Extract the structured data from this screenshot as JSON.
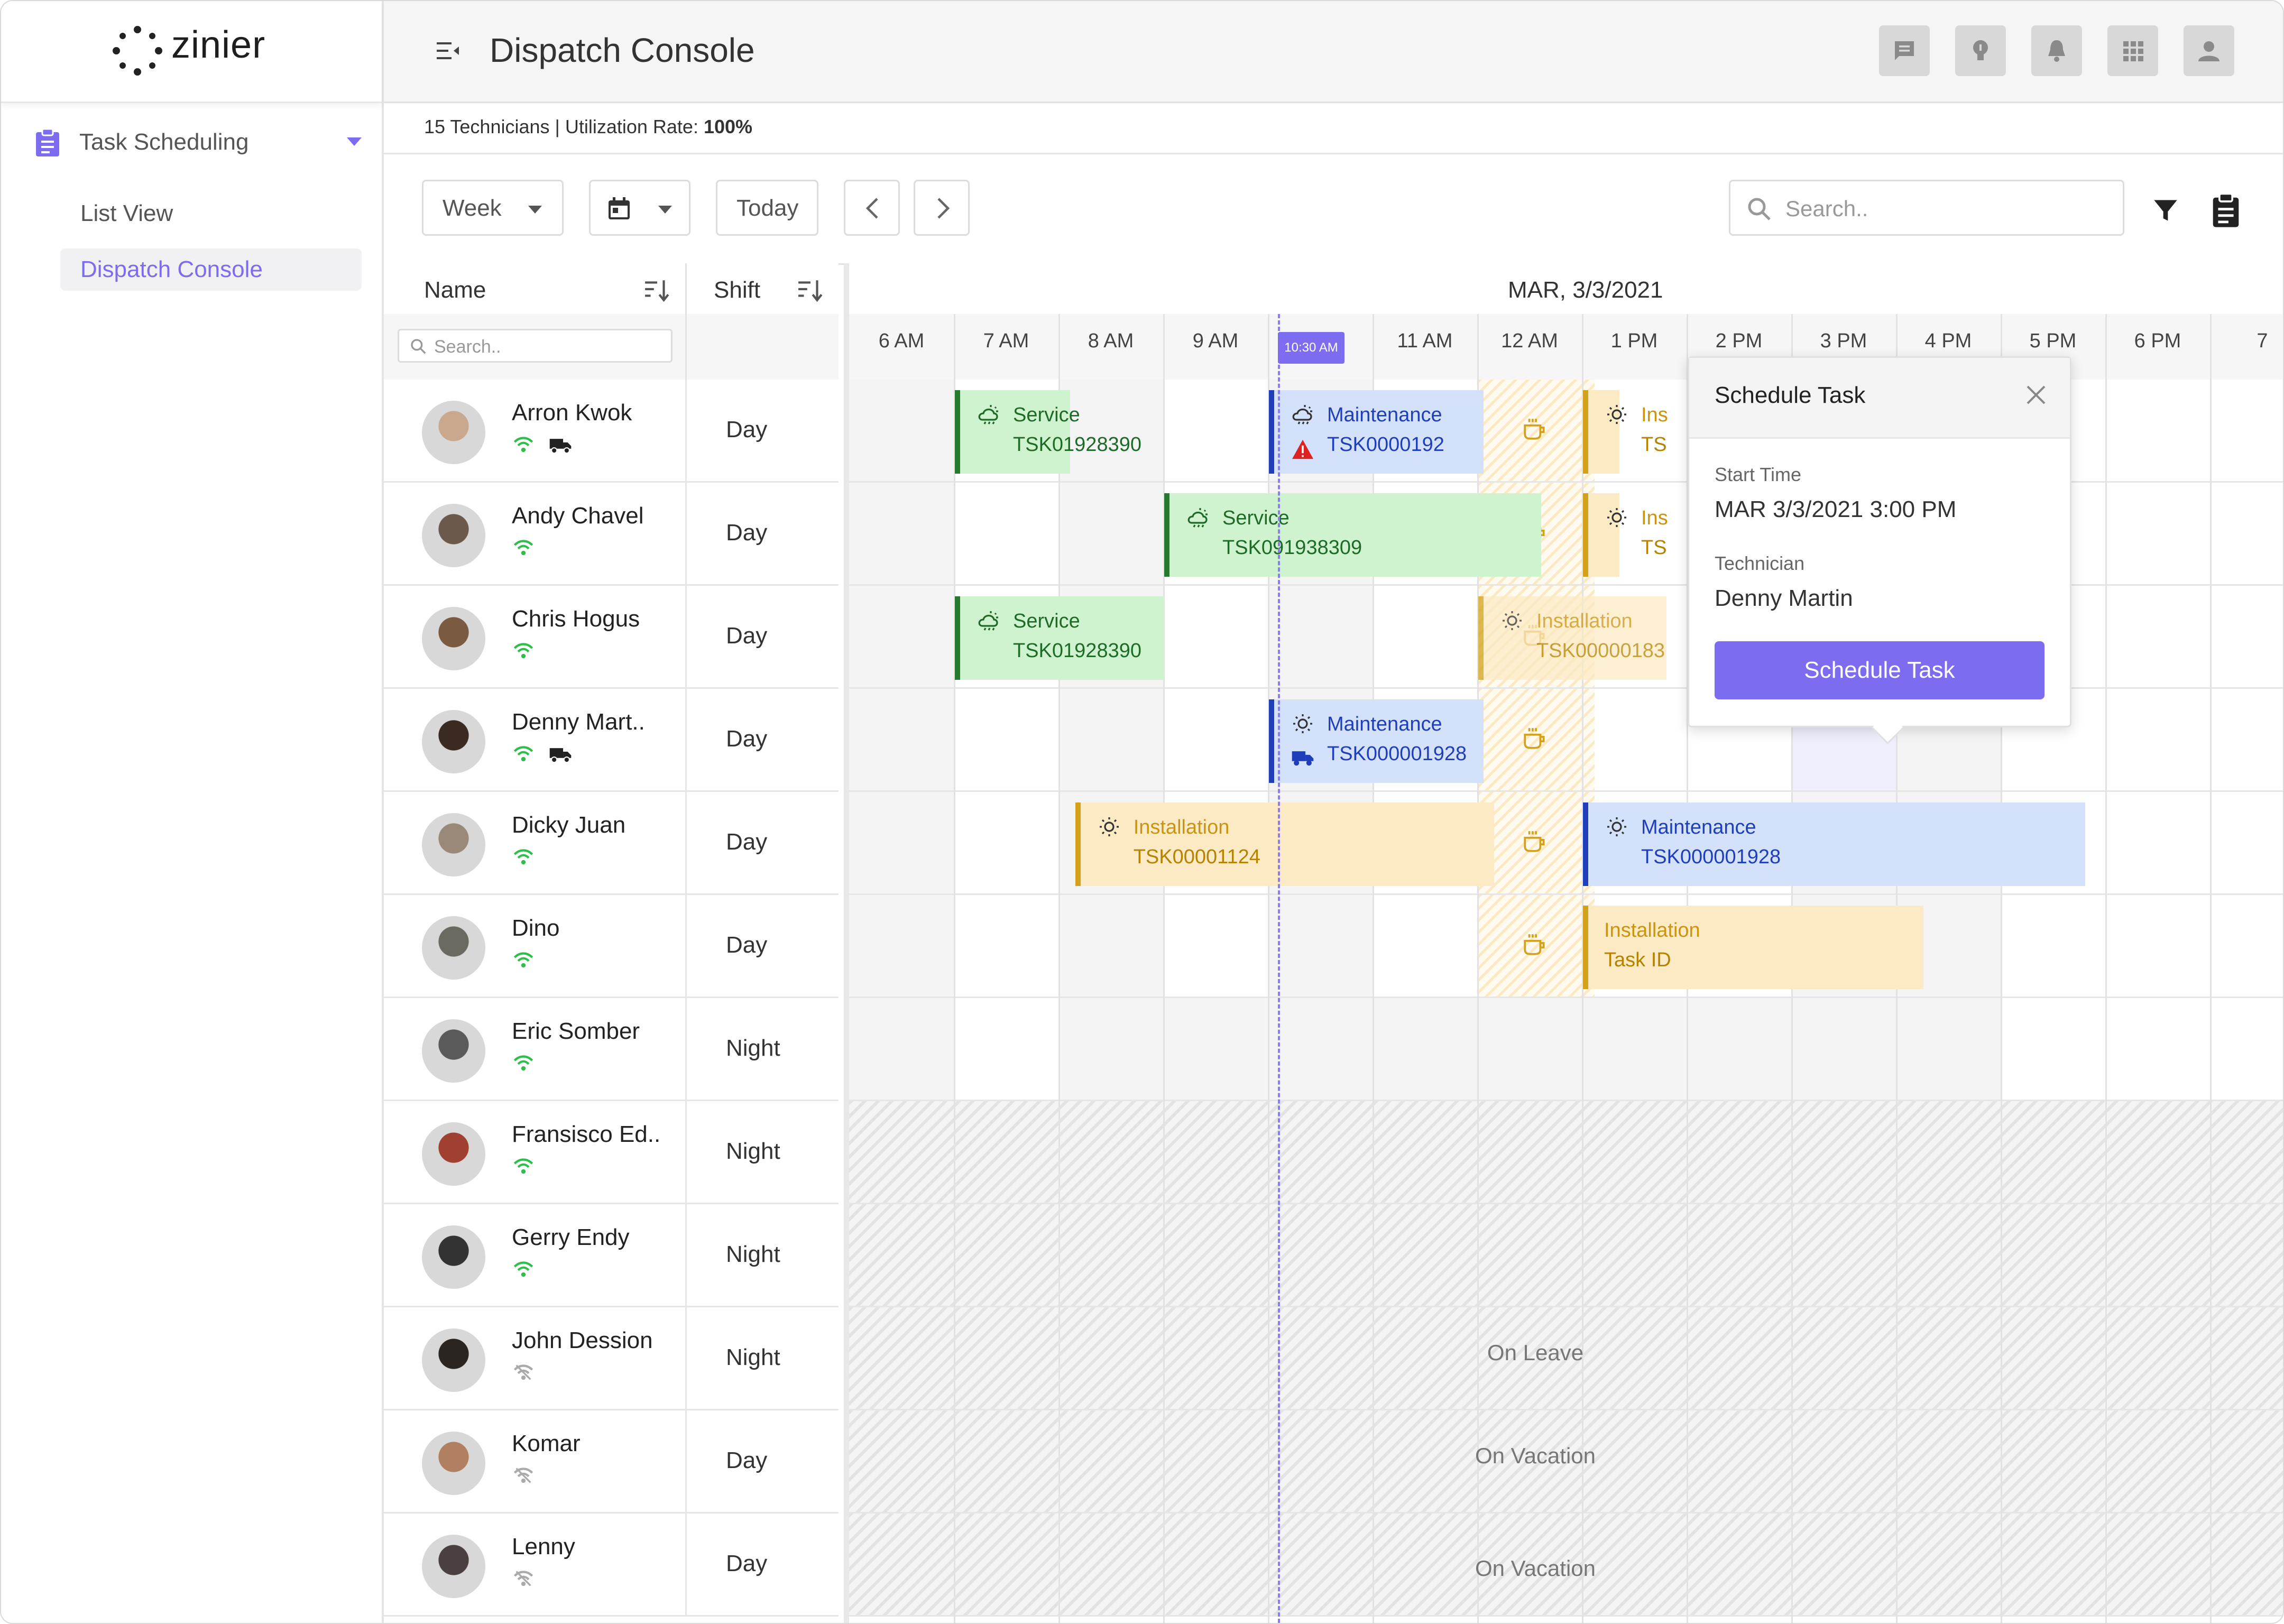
{
  "app": {
    "logo_text": "zinier",
    "page_title": "Dispatch Console"
  },
  "sidebar": {
    "group_label": "Task Scheduling",
    "items": [
      {
        "label": "List View",
        "active": false
      },
      {
        "label": "Dispatch Console",
        "active": true
      }
    ]
  },
  "header_icons": [
    "chat-icon",
    "lightbulb-icon",
    "bell-icon",
    "apps-grid-icon",
    "user-icon"
  ],
  "status": {
    "prefix": "15 Technicians | Utilization Rate: ",
    "rate": "100%"
  },
  "toolbar": {
    "view_select": "Week",
    "today_label": "Today",
    "search_placeholder": "Search.."
  },
  "columns": {
    "name": "Name",
    "shift": "Shift",
    "name_search_placeholder": "Search.."
  },
  "timeline": {
    "date": "MAR, 3/3/2021",
    "hours": [
      "6 AM",
      "7 AM",
      "8 AM",
      "9 AM",
      "10",
      "11 AM",
      "12 AM",
      "1 PM",
      "2 PM",
      "3 PM",
      "4 PM",
      "5 PM",
      "6 PM",
      "7"
    ],
    "now_badge": "10:30 AM"
  },
  "technicians": [
    {
      "name": "Arron Kwok",
      "shift": "Day",
      "online": true,
      "truck": true
    },
    {
      "name": "Andy Chavel",
      "shift": "Day",
      "online": true,
      "truck": false
    },
    {
      "name": "Chris Hogus",
      "shift": "Day",
      "online": true,
      "truck": false
    },
    {
      "name": "Denny Mart..",
      "shift": "Day",
      "online": true,
      "truck": true
    },
    {
      "name": "Dicky Juan",
      "shift": "Day",
      "online": true,
      "truck": false
    },
    {
      "name": "Dino",
      "shift": "Day",
      "online": true,
      "truck": false
    },
    {
      "name": "Eric Somber",
      "shift": "Night",
      "online": true,
      "truck": false
    },
    {
      "name": "Fransisco Ed..",
      "shift": "Night",
      "online": true,
      "truck": false
    },
    {
      "name": "Gerry Endy",
      "shift": "Night",
      "online": true,
      "truck": false
    },
    {
      "name": "John Dession",
      "shift": "Night",
      "online": false,
      "truck": false
    },
    {
      "name": "Komar",
      "shift": "Day",
      "online": false,
      "truck": false
    },
    {
      "name": "Lenny",
      "shift": "Day",
      "online": false,
      "truck": false
    }
  ],
  "tasks": [
    {
      "row": 0,
      "type": "Service",
      "id": "TSK01928390",
      "color": "green",
      "icon": "cloud-sun-icon"
    },
    {
      "row": 0,
      "type": "Maintenance",
      "id": "TSK0000192",
      "color": "blue",
      "icon": "cloud-sun-icon",
      "warning": true
    },
    {
      "row": 0,
      "type": "Ins",
      "id": "TS",
      "color": "yellow",
      "icon": "sun-icon"
    },
    {
      "row": 1,
      "type": "Service",
      "id": "TSK091938309",
      "color": "green",
      "icon": "cloud-sun-icon"
    },
    {
      "row": 1,
      "type": "Ins",
      "id": "TS",
      "color": "yellow",
      "icon": "sun-icon"
    },
    {
      "row": 2,
      "type": "Service",
      "id": "TSK01928390",
      "color": "green",
      "icon": "cloud-sun-icon"
    },
    {
      "row": 2,
      "type": "Installation",
      "id": "TSK00000183",
      "color": "yellow",
      "icon": "sun-icon"
    },
    {
      "row": 3,
      "type": "Maintenance",
      "id": "TSK000001928",
      "color": "blue",
      "icon": "sun-icon"
    },
    {
      "row": 4,
      "type": "Installation",
      "id": "TSK00001124",
      "color": "yellow",
      "icon": "sun-icon"
    },
    {
      "row": 4,
      "type": "Maintenance",
      "id": "TSK000001928",
      "color": "blue",
      "icon": "sun-icon"
    },
    {
      "row": 5,
      "type": "Installation",
      "id": "Task ID",
      "color": "yellow",
      "icon": ""
    }
  ],
  "absences": [
    "On Leave",
    "On Vacation",
    "On Vacation"
  ],
  "popup": {
    "title": "Schedule Task",
    "start_label": "Start Time",
    "start_value": "MAR 3/3/2021 3:00 PM",
    "tech_label": "Technician",
    "tech_value": "Denny Martin",
    "button": "Schedule Task"
  },
  "colors": {
    "accent": "#7b6cf0",
    "green": "#267a2f",
    "blue": "#1f3fba",
    "yellow": "#d4a11a",
    "online": "#2dbf4a"
  }
}
